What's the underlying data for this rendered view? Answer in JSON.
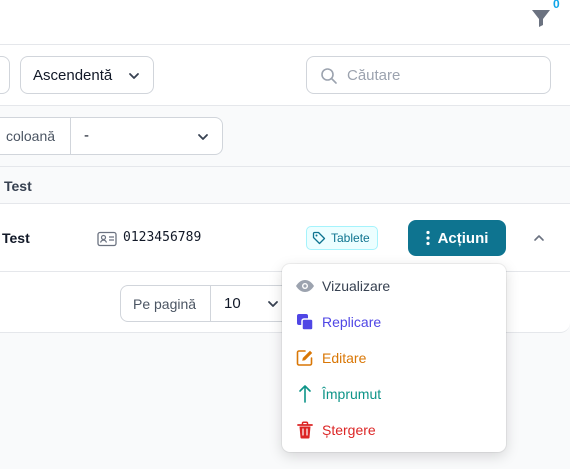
{
  "header": {
    "filter_count": "0"
  },
  "controls": {
    "sort_order": "Ascendentă",
    "search_placeholder": "Căutare"
  },
  "column_filter": {
    "label": "coloană",
    "value": "-"
  },
  "group": {
    "title": "Test"
  },
  "row": {
    "name": "Test",
    "code": "0123456789",
    "tag": "Tablete",
    "actions_label": "Acțiuni"
  },
  "pagination": {
    "label": "Pe pagină",
    "value": "10"
  },
  "menu": {
    "items": [
      {
        "label": "Vizualizare",
        "icon": "eye-icon",
        "color": "#374151"
      },
      {
        "label": "Replicare",
        "icon": "copy-icon",
        "color": "#4f46e5"
      },
      {
        "label": "Editare",
        "icon": "edit-icon",
        "color": "#d97706"
      },
      {
        "label": "Împrumut",
        "icon": "arrow-up-icon",
        "color": "#0d9488"
      },
      {
        "label": "Ștergere",
        "icon": "trash-icon",
        "color": "#dc2626"
      }
    ]
  }
}
